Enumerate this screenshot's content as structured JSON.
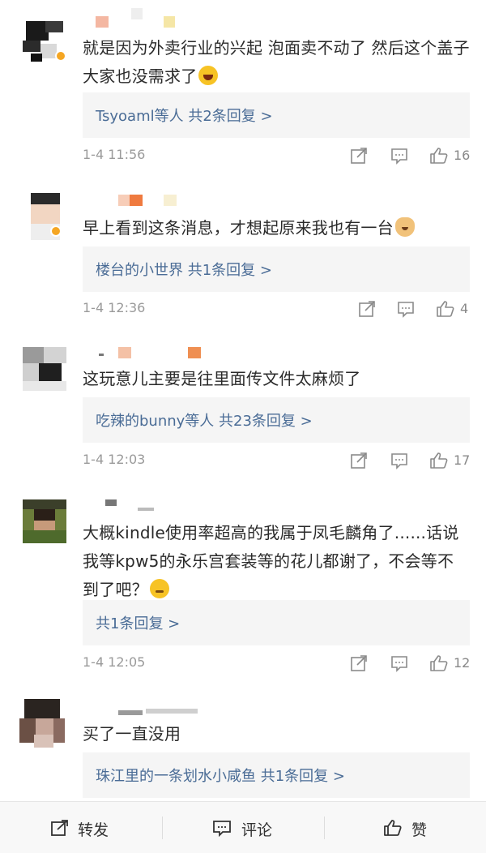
{
  "comments": [
    {
      "text": "就是因为外卖行业的兴起 泡面卖不动了 然后这个盖子 大家也没需求了",
      "emoji": "grinning-laugh-emoji",
      "reply": "Tsyoaml等人 共2条回复 >",
      "time": "1-4 11:56",
      "likes": "16"
    },
    {
      "text": "早上看到这条消息，才想起原来我也有一台",
      "emoji": "doge-emoji",
      "reply": "楼台的小世界 共1条回复 >",
      "time": "1-4 12:36",
      "likes": "4"
    },
    {
      "text": "这玩意儿主要是往里面传文件太麻烦了",
      "reply": "吃辣的bunny等人 共23条回复 >",
      "time": "1-4 12:03",
      "likes": "17"
    },
    {
      "text": "大概kindle使用率超高的我属于凤毛麟角了......话说我等kpw5的永乐宫套装等的花儿都谢了，不会等不到了吧？",
      "emoji": "shy-smile-emoji",
      "reply": "共1条回复 >",
      "time": "1-4 12:05",
      "likes": "12"
    },
    {
      "text": "买了一直没用",
      "reply": "珠江里的一条划水小咸鱼 共1条回复 >"
    }
  ],
  "bottom_bar": {
    "repost": "转发",
    "comment": "评论",
    "like": "赞"
  },
  "icons": {
    "share": "share-icon",
    "comment": "comment-icon",
    "like": "thumbs-up-icon",
    "verified": "verified-badge-icon"
  }
}
